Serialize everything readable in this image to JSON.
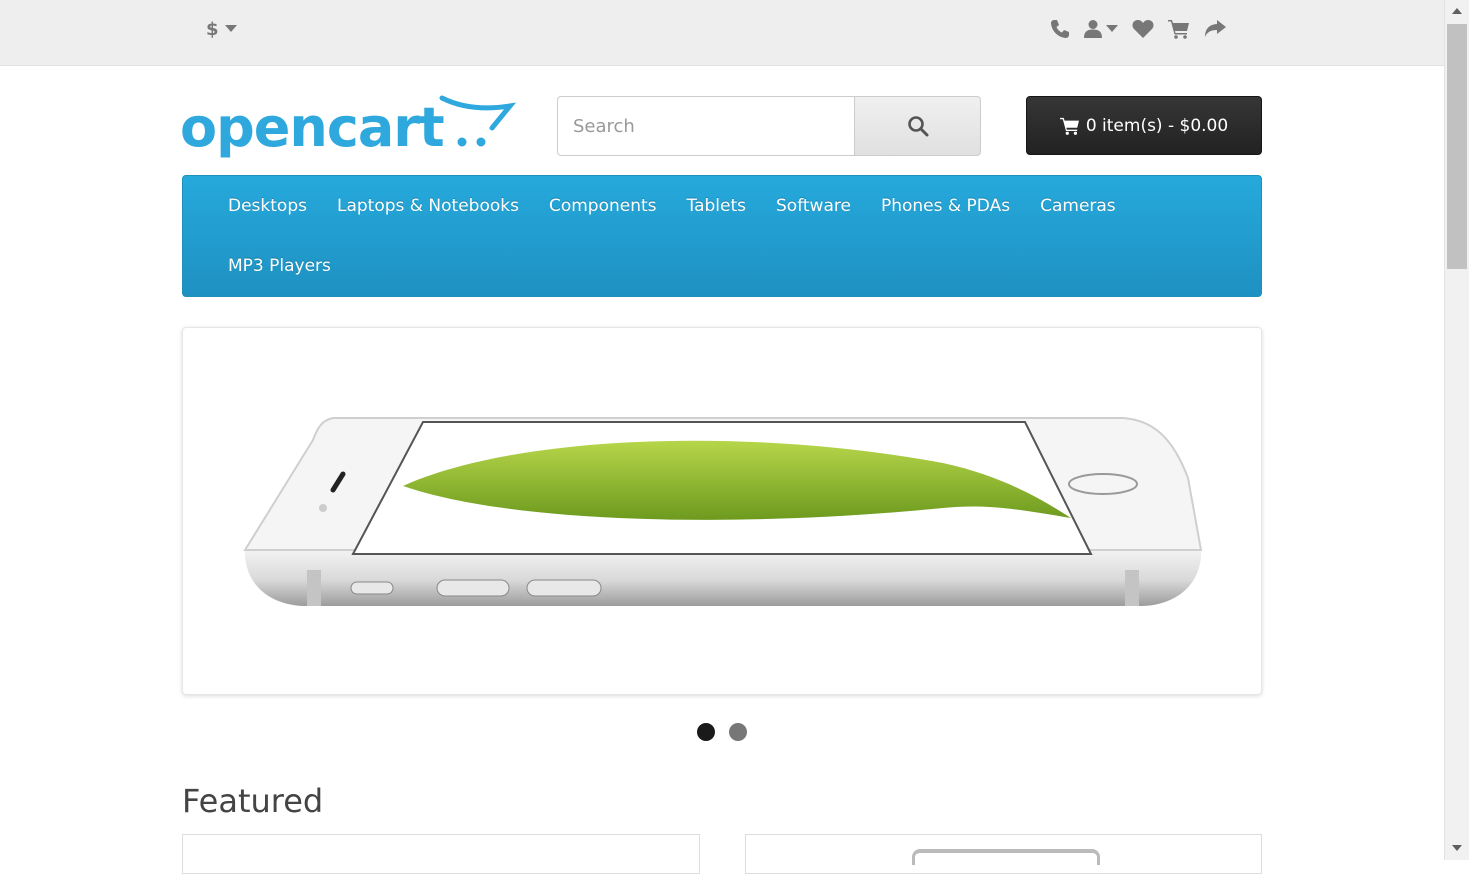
{
  "topbar": {
    "currency_symbol": "$",
    "icons": [
      "phone-icon",
      "user-icon",
      "heart-icon",
      "cart-icon",
      "share-icon"
    ]
  },
  "header": {
    "logo_text": "opencart",
    "search": {
      "placeholder": "Search"
    },
    "cart_label": "0 item(s) - $0.00"
  },
  "menu": {
    "items": [
      "Desktops",
      "Laptops & Notebooks",
      "Components",
      "Tablets",
      "Software",
      "Phones & PDAs",
      "Cameras",
      "MP3 Players"
    ]
  },
  "slideshow": {
    "slide_count": 2,
    "active_index": 0
  },
  "featured": {
    "heading": "Featured"
  },
  "colors": {
    "brand_blue": "#229ac8",
    "cart_button": "#2b2b2b",
    "logo": "#2fa8dd"
  }
}
